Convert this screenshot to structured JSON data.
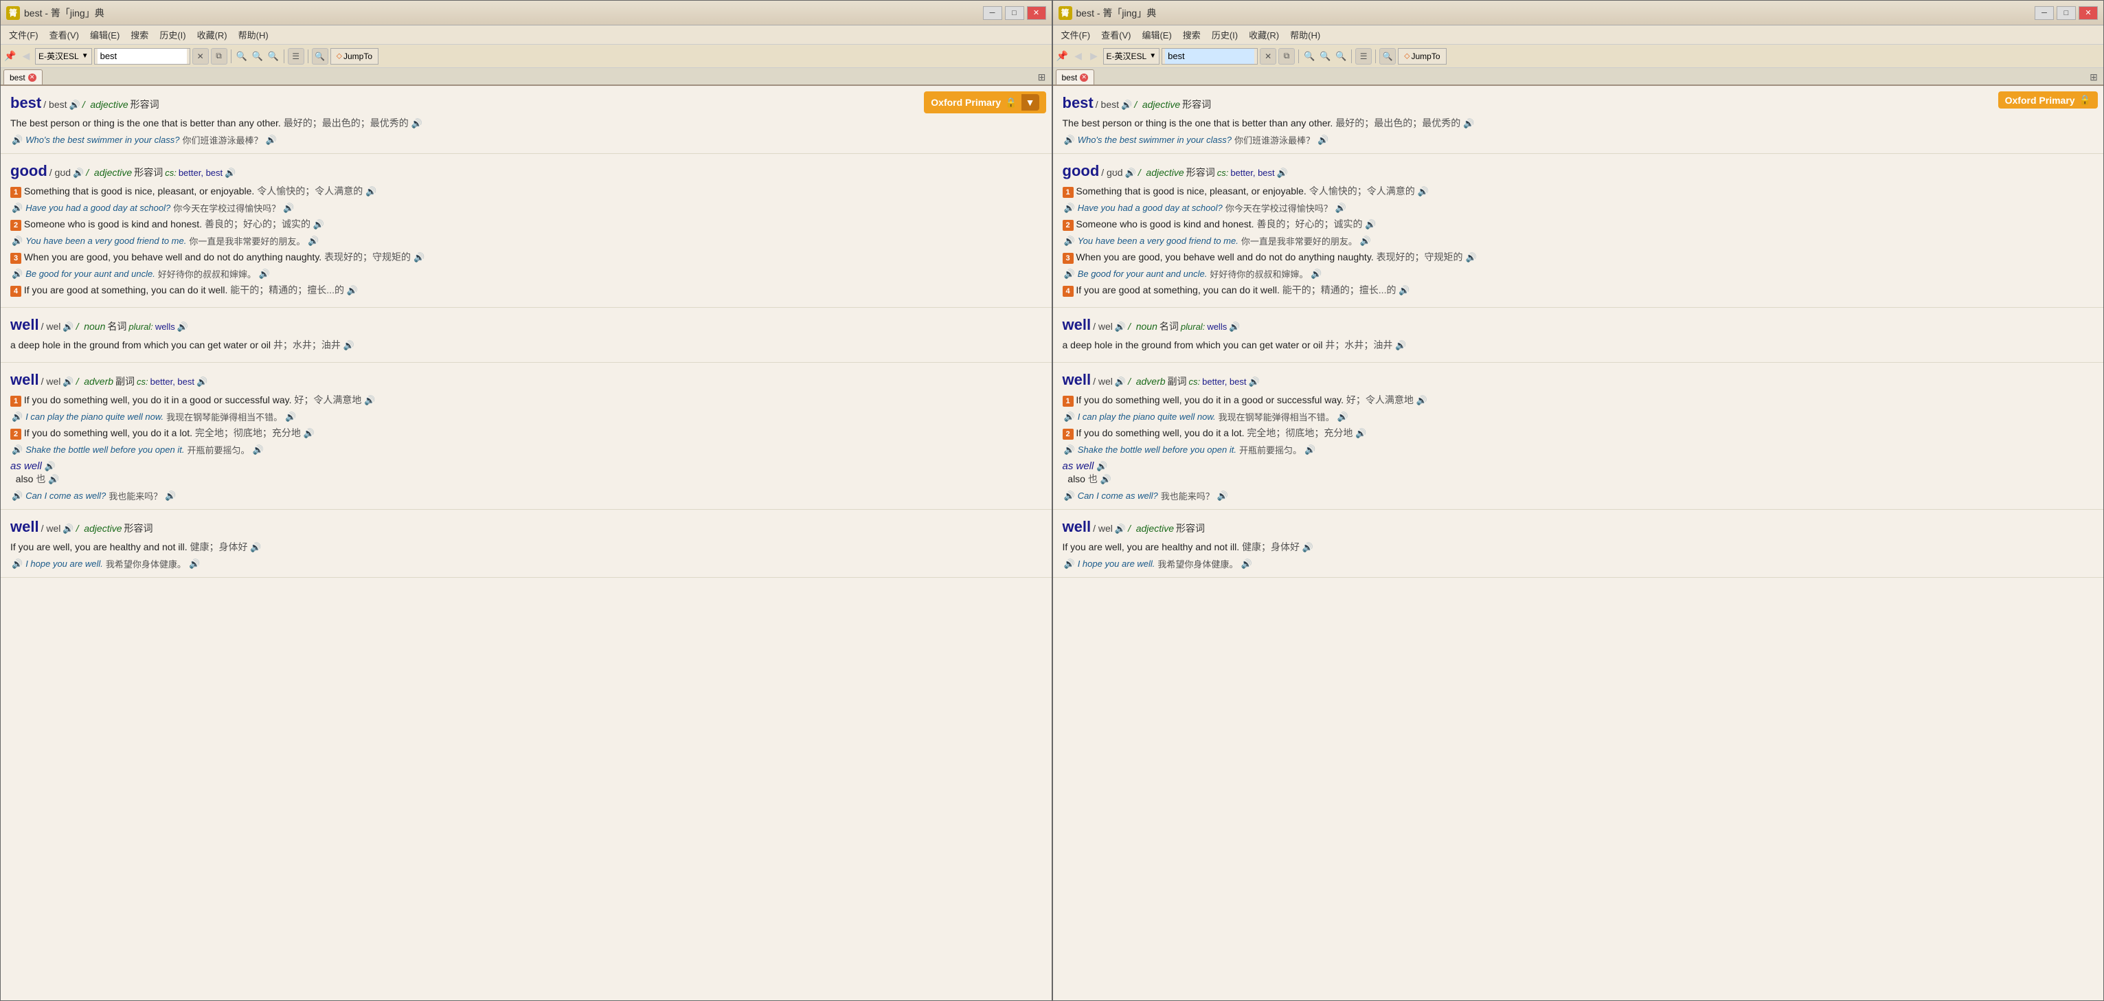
{
  "windows": [
    {
      "id": "left",
      "title": "best - 箐「jing」典",
      "menu": [
        "文件(F)",
        "查看(V)",
        "编辑(E)",
        "搜索",
        "历史(I)",
        "收藏(R)",
        "帮助(H)"
      ],
      "dict_selector": "E-英汉ESL",
      "search_value": "best",
      "tab_label": "best",
      "oxford_label": "Oxford Primary",
      "jumpto_label": "JumpTo",
      "entries": [
        {
          "id": "best-adj",
          "headword": "best",
          "phonetic": "/ best",
          "pos": "adjective",
          "pos_zh": "形容词",
          "cs": null,
          "definitions": [
            {
              "text": "The best person or thing is the one that is better than any other.",
              "zh": "最好的；最出色的；最优秀的",
              "examples": [
                {
                  "en": "Who's the best swimmer in your class?",
                  "zh": "你们班谁游泳最棒？",
                  "num": null
                }
              ]
            }
          ]
        },
        {
          "id": "good-adj",
          "headword": "good",
          "phonetic": "/ gʊd",
          "pos": "adjective",
          "pos_zh": "形容词",
          "cs": "better, best",
          "definitions": [
            {
              "text": "Something that is good is nice, pleasant, or enjoyable.",
              "zh": "令人愉快的；令人满意的",
              "examples": [
                {
                  "en": "Have you had a good day at school?",
                  "zh": "你今天在学校过得愉快吗？",
                  "num": null
                }
              ],
              "num": "1"
            },
            {
              "text": "Someone who is good is kind and honest.",
              "zh": "善良的；好心的；诚实的",
              "examples": [
                {
                  "en": "You have been a very good friend to me.",
                  "zh": "你一直是我非常要好的朋友。",
                  "num": null
                }
              ],
              "num": "2"
            },
            {
              "text": "When you are good, you behave well and do not do anything naughty.",
              "zh": "表现好的；守规矩的",
              "examples": [
                {
                  "en": "Be good for your aunt and uncle.",
                  "zh": "好好待你的叔叔和婶婶。",
                  "num": null
                }
              ],
              "num": "3"
            },
            {
              "text": "If you are good at something, you can do it well.",
              "zh": "能干的；精通的；擅长...的",
              "examples": [],
              "num": "4"
            }
          ]
        },
        {
          "id": "well-noun",
          "headword": "well",
          "phonetic": "/ wel",
          "pos": "noun",
          "pos_zh": "名词",
          "cs_label": "plural:",
          "cs": "wells",
          "definitions": [
            {
              "text": "a deep hole in the ground from which you can get water or oil",
              "zh": "井；水井；油井",
              "examples": []
            }
          ]
        },
        {
          "id": "well-adv",
          "headword": "well",
          "phonetic": "/ wel",
          "pos": "adverb",
          "pos_zh": "副词",
          "cs": "better, best",
          "definitions": [
            {
              "text": "If you do something well, you do it in a good or successful way.",
              "zh": "好；令人满意地",
              "examples": [
                {
                  "en": "I can play the piano quite well now.",
                  "zh": "我现在钢琴能弹得相当不错。",
                  "num": null
                }
              ],
              "num": "1"
            },
            {
              "text": "If you do something well, you do it a lot.",
              "zh": "完全地；彻底地；充分地",
              "examples": [
                {
                  "en": "Shake the bottle well before you open it.",
                  "zh": "开瓶前要摇匀。",
                  "num": null
                }
              ],
              "num": "2"
            }
          ],
          "phrase": {
            "label": "as well",
            "definition": "also",
            "zh_def": "也",
            "examples": [
              {
                "en": "Can I come as well?",
                "zh": "我也能来吗？",
                "num": null
              }
            ]
          }
        },
        {
          "id": "well-adj",
          "headword": "well",
          "phonetic": "/ wel",
          "pos": "adjective",
          "pos_zh": "形容词",
          "definitions": [
            {
              "text": "If you are well, you are healthy and not ill.",
              "zh": "健康；身体好",
              "examples": [
                {
                  "en": "I hope you are well.",
                  "zh": "我希望你身体健康。",
                  "num": null
                }
              ]
            }
          ]
        }
      ]
    },
    {
      "id": "right",
      "title": "best - 箐「jing」典",
      "menu": [
        "文件(F)",
        "查看(V)",
        "编辑(E)",
        "搜索",
        "历史(I)",
        "收藏(R)",
        "帮助(H)"
      ],
      "dict_selector": "E-英汉ESL",
      "search_value": "best",
      "tab_label": "best",
      "oxford_label": "Oxford Primary",
      "jumpto_label": "JumpTo",
      "entries": [
        {
          "id": "best-adj-r",
          "headword": "best",
          "phonetic": "/ best",
          "pos": "adjective",
          "pos_zh": "形容词",
          "cs": null,
          "definitions": [
            {
              "text": "The best person or thing is the one that is better than any other.",
              "zh": "最好的；最出色的；最优秀的",
              "examples": [
                {
                  "en": "Who's the best swimmer in your class?",
                  "zh": "你们班谁游泳最棒？",
                  "num": null
                }
              ]
            }
          ]
        },
        {
          "id": "good-adj-r",
          "headword": "good",
          "phonetic": "/ gʊd",
          "pos": "adjective",
          "pos_zh": "形容词",
          "cs": "better, best",
          "definitions": [
            {
              "text": "Something that is good is nice, pleasant, or enjoyable.",
              "zh": "令人愉快的；令人满意的",
              "examples": [
                {
                  "en": "Have you had a good day at school?",
                  "zh": "你今天在学校过得愉快吗？",
                  "num": null
                }
              ],
              "num": "1"
            },
            {
              "text": "Someone who is good is kind and honest.",
              "zh": "善良的；好心的；诚实的",
              "examples": [
                {
                  "en": "You have been a very good friend to me.",
                  "zh": "你一直是我非常要好的朋友。",
                  "num": null
                }
              ],
              "num": "2"
            },
            {
              "text": "When you are good, you behave well and do not do anything naughty.",
              "zh": "表现好的；守规矩的",
              "examples": [
                {
                  "en": "Be good for your aunt and uncle.",
                  "zh": "好好待你的叔叔和婶婶。",
                  "num": null
                }
              ],
              "num": "3"
            },
            {
              "text": "If you are good at something, you can do it well.",
              "zh": "能干的；精通的；擅长...的",
              "examples": [],
              "num": "4"
            }
          ]
        },
        {
          "id": "well-noun-r",
          "headword": "well",
          "phonetic": "/ wel",
          "pos": "noun",
          "pos_zh": "名词",
          "cs_label": "plural:",
          "cs": "wells",
          "definitions": [
            {
              "text": "a deep hole in the ground from which you can get water or oil",
              "zh": "井；水井；油井",
              "examples": []
            }
          ]
        },
        {
          "id": "well-adv-r",
          "headword": "well",
          "phonetic": "/ wel",
          "pos": "adverb",
          "pos_zh": "副词",
          "cs": "better, best",
          "definitions": [
            {
              "text": "If you do something well, you do it in a good or successful way.",
              "zh": "好；令人满意地",
              "examples": [
                {
                  "en": "I can play the piano quite well now.",
                  "zh": "我现在钢琴能弹得相当不错。",
                  "num": null
                }
              ],
              "num": "1"
            },
            {
              "text": "If you do something well, you do it a lot.",
              "zh": "完全地；彻底地；充分地",
              "examples": [
                {
                  "en": "Shake the bottle well before you open it.",
                  "zh": "开瓶前要摇匀。",
                  "num": null
                }
              ],
              "num": "2"
            }
          ],
          "phrase": {
            "label": "as well",
            "definition": "also",
            "zh_def": "也",
            "examples": [
              {
                "en": "Can I come as well?",
                "zh": "我也能来吗？",
                "num": null
              }
            ]
          }
        },
        {
          "id": "well-adj-r",
          "headword": "well",
          "phonetic": "/ wel",
          "pos": "adjective",
          "pos_zh": "形容词",
          "definitions": [
            {
              "text": "If you are well, you are healthy and not ill.",
              "zh": "健康；身体好",
              "examples": [
                {
                  "en": "I hope you are well.",
                  "zh": "我希望你身体健康。",
                  "num": null
                }
              ]
            }
          ]
        }
      ]
    }
  ]
}
